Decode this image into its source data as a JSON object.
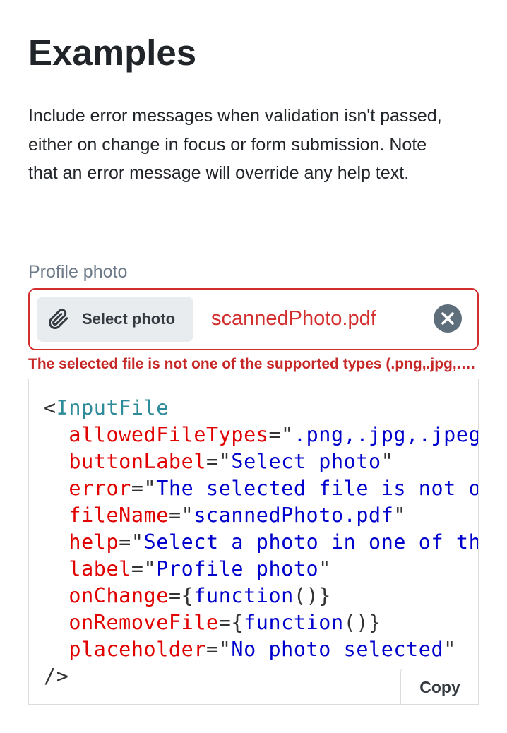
{
  "page": {
    "heading": "Examples",
    "intro": "Include error messages when validation isn't passed, either on change in focus or form submission. Note that an error message will override any help text."
  },
  "file_input": {
    "label": "Profile photo",
    "button_label": "Select photo",
    "file_name": "scannedPhoto.pdf",
    "error": "The selected file is not one of the supported types (.png,.jpg,.jpeg)"
  },
  "code": {
    "lines": [
      [
        {
          "t": "punct",
          "v": "<"
        },
        {
          "t": "tag",
          "v": "InputFile"
        }
      ],
      [
        {
          "t": "punct",
          "v": "  "
        },
        {
          "t": "attr",
          "v": "allowedFileTypes"
        },
        {
          "t": "punct",
          "v": "=\""
        },
        {
          "t": "str",
          "v": ".png,.jpg,.jpeg"
        },
        {
          "t": "punct",
          "v": "\""
        }
      ],
      [
        {
          "t": "punct",
          "v": "  "
        },
        {
          "t": "attr",
          "v": "buttonLabel"
        },
        {
          "t": "punct",
          "v": "=\""
        },
        {
          "t": "str",
          "v": "Select photo"
        },
        {
          "t": "punct",
          "v": "\""
        }
      ],
      [
        {
          "t": "punct",
          "v": "  "
        },
        {
          "t": "attr",
          "v": "error"
        },
        {
          "t": "punct",
          "v": "=\""
        },
        {
          "t": "str",
          "v": "The selected file is not one of the supported types"
        },
        {
          "t": "punct",
          "v": "\""
        }
      ],
      [
        {
          "t": "punct",
          "v": "  "
        },
        {
          "t": "attr",
          "v": "fileName"
        },
        {
          "t": "punct",
          "v": "=\""
        },
        {
          "t": "str",
          "v": "scannedPhoto.pdf"
        },
        {
          "t": "punct",
          "v": "\""
        }
      ],
      [
        {
          "t": "punct",
          "v": "  "
        },
        {
          "t": "attr",
          "v": "help"
        },
        {
          "t": "punct",
          "v": "=\""
        },
        {
          "t": "str",
          "v": "Select a photo in one of the supported formats"
        },
        {
          "t": "punct",
          "v": "\""
        }
      ],
      [
        {
          "t": "punct",
          "v": "  "
        },
        {
          "t": "attr",
          "v": "label"
        },
        {
          "t": "punct",
          "v": "=\""
        },
        {
          "t": "str",
          "v": "Profile photo"
        },
        {
          "t": "punct",
          "v": "\""
        }
      ],
      [
        {
          "t": "punct",
          "v": "  "
        },
        {
          "t": "attr",
          "v": "onChange"
        },
        {
          "t": "punct",
          "v": "={"
        },
        {
          "t": "str",
          "v": "function"
        },
        {
          "t": "punct",
          "v": "()}"
        }
      ],
      [
        {
          "t": "punct",
          "v": "  "
        },
        {
          "t": "attr",
          "v": "onRemoveFile"
        },
        {
          "t": "punct",
          "v": "={"
        },
        {
          "t": "str",
          "v": "function"
        },
        {
          "t": "punct",
          "v": "()}"
        }
      ],
      [
        {
          "t": "punct",
          "v": "  "
        },
        {
          "t": "attr",
          "v": "placeholder"
        },
        {
          "t": "punct",
          "v": "=\""
        },
        {
          "t": "str",
          "v": "No photo selected"
        },
        {
          "t": "punct",
          "v": "\""
        }
      ],
      [
        {
          "t": "punct",
          "v": "/>"
        }
      ]
    ],
    "copy_label": "Copy"
  },
  "icons": {
    "select_button": "paperclip-icon",
    "clear_button": "close-circle-icon"
  },
  "colors": {
    "error": "#d32f2f",
    "code_tag": "#2e8b9a",
    "code_attr": "#e00000",
    "code_string": "#0000cc"
  }
}
